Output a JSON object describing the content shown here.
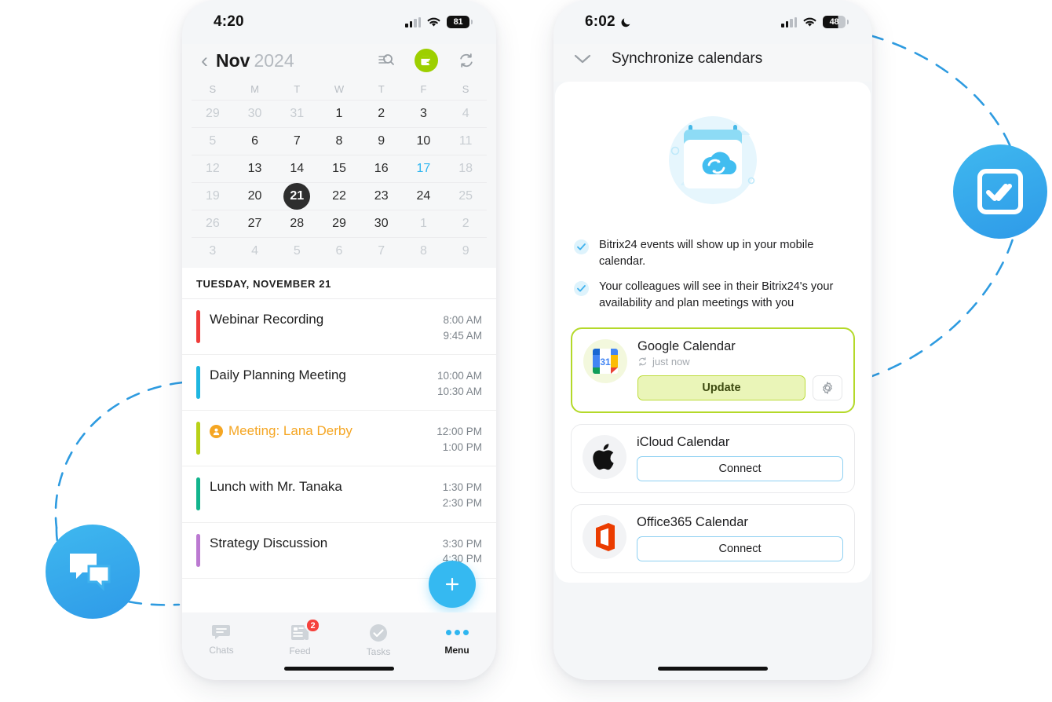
{
  "left_phone": {
    "status": {
      "time": "4:20",
      "battery": "81",
      "signal_icon": "cellular-bars-icon",
      "wifi_icon": "wifi-icon"
    },
    "calendar": {
      "back_icon": "chevron-left-icon",
      "month": "Nov",
      "year": "2024",
      "icons": [
        "filter-search-icon",
        "calendar-share-icon",
        "sync-refresh-icon"
      ],
      "accent_green": "#9dcf00",
      "dow": [
        "S",
        "M",
        "T",
        "W",
        "T",
        "F",
        "S"
      ],
      "weeks": [
        [
          {
            "d": "29",
            "s": "mut"
          },
          {
            "d": "30",
            "s": "mut"
          },
          {
            "d": "31",
            "s": "mut"
          },
          {
            "d": "1",
            "s": ""
          },
          {
            "d": "2",
            "s": ""
          },
          {
            "d": "3",
            "s": ""
          },
          {
            "d": "4",
            "s": "mut"
          }
        ],
        [
          {
            "d": "5",
            "s": "mut"
          },
          {
            "d": "6",
            "s": ""
          },
          {
            "d": "7",
            "s": ""
          },
          {
            "d": "8",
            "s": ""
          },
          {
            "d": "9",
            "s": ""
          },
          {
            "d": "10",
            "s": ""
          },
          {
            "d": "11",
            "s": "mut"
          }
        ],
        [
          {
            "d": "12",
            "s": "mut"
          },
          {
            "d": "13",
            "s": ""
          },
          {
            "d": "14",
            "s": ""
          },
          {
            "d": "15",
            "s": ""
          },
          {
            "d": "16",
            "s": ""
          },
          {
            "d": "17",
            "s": "today"
          },
          {
            "d": "18",
            "s": "mut"
          }
        ],
        [
          {
            "d": "19",
            "s": "mut"
          },
          {
            "d": "20",
            "s": ""
          },
          {
            "d": "21",
            "s": "sel"
          },
          {
            "d": "22",
            "s": ""
          },
          {
            "d": "23",
            "s": ""
          },
          {
            "d": "24",
            "s": ""
          },
          {
            "d": "25",
            "s": "mut"
          }
        ],
        [
          {
            "d": "26",
            "s": "mut"
          },
          {
            "d": "27",
            "s": ""
          },
          {
            "d": "28",
            "s": ""
          },
          {
            "d": "29",
            "s": ""
          },
          {
            "d": "30",
            "s": ""
          },
          {
            "d": "1",
            "s": "mut"
          },
          {
            "d": "2",
            "s": "mut"
          }
        ],
        [
          {
            "d": "3",
            "s": "mut"
          },
          {
            "d": "4",
            "s": "mut"
          },
          {
            "d": "5",
            "s": "mut"
          },
          {
            "d": "6",
            "s": "mut"
          },
          {
            "d": "7",
            "s": "mut"
          },
          {
            "d": "8",
            "s": "mut"
          },
          {
            "d": "9",
            "s": "mut"
          }
        ]
      ]
    },
    "agenda": {
      "header": "TUESDAY, NOVEMBER 21",
      "events": [
        {
          "title": "Webinar Recording",
          "start": "8:00 AM",
          "end": "9:45 AM",
          "color": "#ef3b39",
          "warn": false
        },
        {
          "title": "Daily Planning Meeting",
          "start": "10:00 AM",
          "end": "10:30 AM",
          "color": "#1eb6e0",
          "warn": false
        },
        {
          "title": "Meeting: Lana Derby",
          "start": "12:00 PM",
          "end": "1:00 PM",
          "color": "#b8d118",
          "warn": true
        },
        {
          "title": "Lunch with Mr. Tanaka",
          "start": "1:30 PM",
          "end": "2:30 PM",
          "color": "#12b48d",
          "warn": false
        },
        {
          "title": "Strategy Discussion",
          "start": "3:30 PM",
          "end": "4:30 PM",
          "color": "#bb79d1",
          "warn": false
        }
      ]
    },
    "fab": {
      "icon": "plus-icon",
      "color": "#35b9f1"
    },
    "tabbar": [
      {
        "label": "Chats",
        "icon": "chat-bubble-icon",
        "badge": "",
        "active": false
      },
      {
        "label": "Feed",
        "icon": "news-feed-icon",
        "badge": "2",
        "active": false
      },
      {
        "label": "Tasks",
        "icon": "check-circle-icon",
        "badge": "",
        "active": false
      },
      {
        "label": "Menu",
        "icon": "three-dots-icon",
        "badge": "",
        "active": true
      }
    ]
  },
  "right_phone": {
    "status": {
      "time": "6:02",
      "moon_icon": "crescent-moon-icon",
      "battery": "48"
    },
    "header": {
      "collapse_icon": "chevron-down-icon",
      "title": "Synchronize calendars"
    },
    "illustration": "calendar-cloud-sync-icon",
    "bullets": [
      "Bitrix24 events will show up in your mobile calendar.",
      "Your colleagues will see in their Bitrix24's your availability and plan meetings with you"
    ],
    "cards": [
      {
        "name": "Google Calendar",
        "icon": "google-calendar-icon",
        "status": "just now",
        "status_icon": "sync-refresh-icon",
        "primary_label": "Update",
        "gear_icon": "gear-icon",
        "highlighted": true
      },
      {
        "name": "iCloud Calendar",
        "icon": "apple-logo-icon",
        "primary_label": "Connect",
        "highlighted": false
      },
      {
        "name": "Office365 Calendar",
        "icon": "office365-icon",
        "primary_label": "Connect",
        "highlighted": false
      }
    ]
  },
  "decor": {
    "chats_circle_icon": "chat-bubbles-icon",
    "tasks_circle_icon": "double-check-square-icon",
    "arc_color": "#2e9be0"
  }
}
